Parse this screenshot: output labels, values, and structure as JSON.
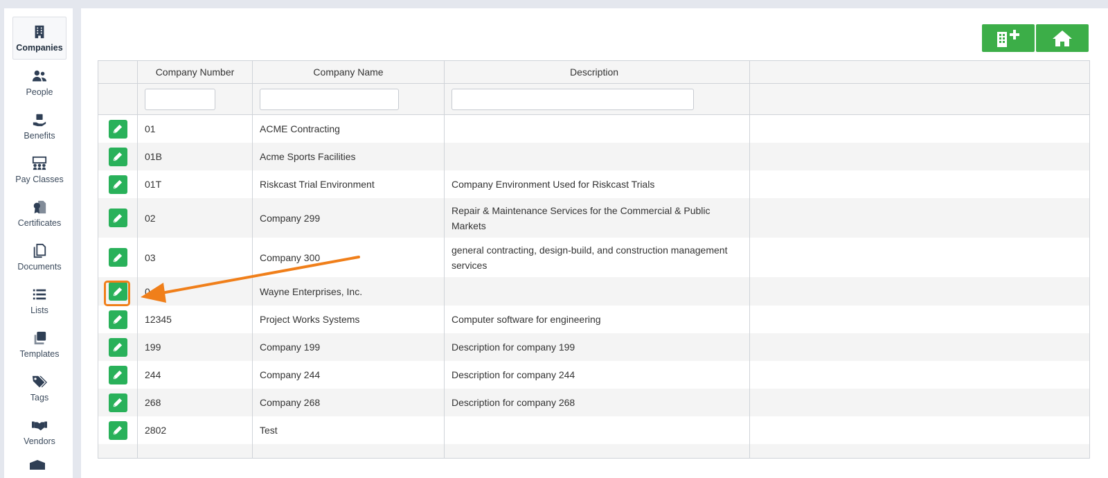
{
  "sidebar": {
    "items": [
      {
        "label": "Companies",
        "icon": "building-icon",
        "active": true
      },
      {
        "label": "People",
        "icon": "people-icon"
      },
      {
        "label": "Benefits",
        "icon": "benefits-icon"
      },
      {
        "label": "Pay Classes",
        "icon": "pay-classes-icon"
      },
      {
        "label": "Certificates",
        "icon": "certificate-icon"
      },
      {
        "label": "Documents",
        "icon": "documents-icon"
      },
      {
        "label": "Lists",
        "icon": "list-icon"
      },
      {
        "label": "Templates",
        "icon": "templates-icon"
      },
      {
        "label": "Tags",
        "icon": "tags-icon"
      },
      {
        "label": "Vendors",
        "icon": "handshake-icon"
      }
    ]
  },
  "toolbar": {
    "add_company_icon": "building-plus-icon",
    "home_icon": "home-icon",
    "accent": "#3cae48"
  },
  "table": {
    "columns": [
      "",
      "Company Number",
      "Company Name",
      "Description",
      ""
    ],
    "rows": [
      {
        "number": "01",
        "name": "ACME Contracting",
        "description": ""
      },
      {
        "number": "01B",
        "name": "Acme Sports Facilities",
        "description": ""
      },
      {
        "number": "01T",
        "name": "Riskcast Trial Environment",
        "description": "Company Environment Used for Riskcast Trials"
      },
      {
        "number": "02",
        "name": "Company 299",
        "description": "Repair & Maintenance Services for the Commercial & Public Markets"
      },
      {
        "number": "03",
        "name": "Company 300",
        "description": "general contracting, design-build, and construction management services"
      },
      {
        "number": "0",
        "name": "Wayne Enterprises, Inc.",
        "description": ""
      },
      {
        "number": "12345",
        "name": "Project Works Systems",
        "description": "Computer software for engineering"
      },
      {
        "number": "199",
        "name": "Company 199",
        "description": "Description for company 199"
      },
      {
        "number": "244",
        "name": "Company 244",
        "description": "Description for company 244"
      },
      {
        "number": "268",
        "name": "Company 268",
        "description": "Description for company 268"
      },
      {
        "number": "2802",
        "name": "Test",
        "description": ""
      }
    ]
  },
  "annotation": {
    "color": "#f07f1a",
    "target": "edit button of row 6"
  }
}
